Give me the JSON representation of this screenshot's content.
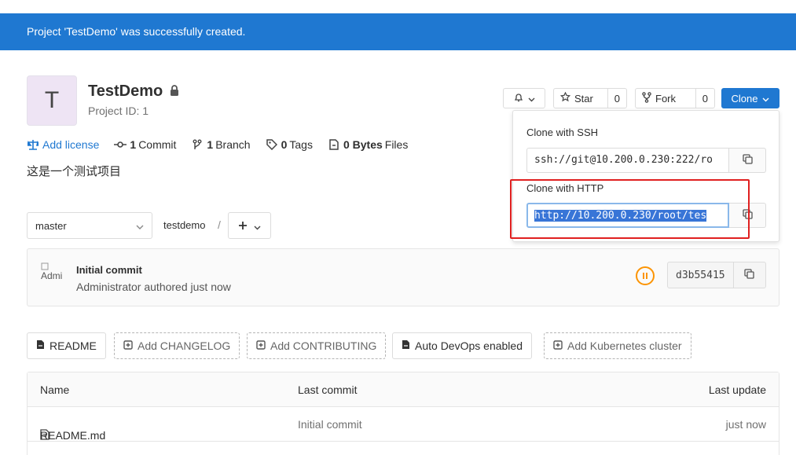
{
  "flash": {
    "message": "Project 'TestDemo' was successfully created."
  },
  "project": {
    "avatar_letter": "T",
    "name": "TestDemo",
    "id_label": "Project ID: 1",
    "description": "这是一个测试项目"
  },
  "stats": {
    "license": "Add license",
    "commits_count": "1",
    "commits_label": "Commit",
    "branches_count": "1",
    "branches_label": "Branch",
    "tags_count": "0",
    "tags_label": "Tags",
    "size_value": "0 Bytes",
    "size_label": "Files"
  },
  "actions": {
    "star_label": "Star",
    "star_count": "0",
    "fork_label": "Fork",
    "fork_count": "0",
    "clone_label": "Clone"
  },
  "clone": {
    "ssh_label": "Clone with SSH",
    "ssh_url": "ssh://git@10.200.0.230:222/ro",
    "http_label": "Clone with HTTP",
    "http_url": "http://10.200.0.230/root/tes"
  },
  "repo_nav": {
    "branch": "master",
    "path": "testdemo",
    "separator": "/"
  },
  "last_commit": {
    "avatar_alt": "Admi",
    "title": "Initial commit",
    "meta": "Administrator authored just now",
    "sha": "d3b55415",
    "pipeline_status": "paused"
  },
  "quick_links": [
    {
      "label": "README",
      "style": "solid",
      "icon": "file-icon"
    },
    {
      "label": "Add CHANGELOG",
      "style": "dashed",
      "icon": "plus-square-icon"
    },
    {
      "label": "Add CONTRIBUTING",
      "style": "dashed",
      "icon": "plus-square-icon"
    },
    {
      "label": "Auto DevOps enabled",
      "style": "solid",
      "icon": "file-icon"
    },
    {
      "label": "Add Kubernetes cluster",
      "style": "dashed",
      "icon": "plus-square-icon"
    }
  ],
  "file_table": {
    "headers": {
      "name": "Name",
      "last_commit": "Last commit",
      "last_update": "Last update"
    },
    "rows": [
      {
        "name": "README.md",
        "last_commit": "Initial commit",
        "last_update": "just now"
      }
    ]
  },
  "colors": {
    "primary": "#1f78d1",
    "highlight": "#e02020",
    "pipeline": "#fc9403"
  }
}
